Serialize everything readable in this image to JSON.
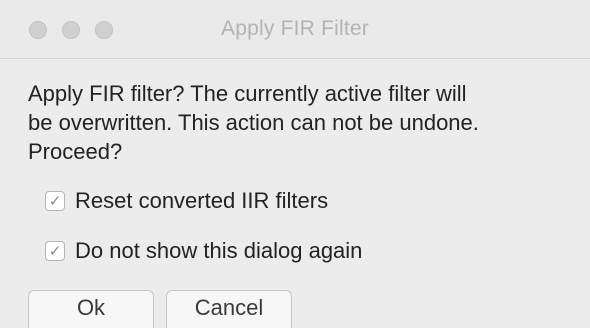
{
  "window": {
    "title": "Apply FIR Filter"
  },
  "dialog": {
    "message_lines": [
      "Apply FIR filter? The currently active filter will",
      "be overwritten. This action can not be undone.",
      "Proceed?"
    ],
    "options": [
      {
        "label": "Reset converted IIR filters",
        "checked": true,
        "mark": "✓"
      },
      {
        "label": "Do not show this dialog again",
        "checked": true,
        "mark": "✓"
      }
    ],
    "buttons": {
      "ok_label": "Ok",
      "cancel_label": "Cancel"
    }
  },
  "icons": {
    "window_controls": [
      "close-icon",
      "minimize-icon",
      "zoom-icon"
    ],
    "checkbox_mark": "checkmark-icon"
  },
  "colors": {
    "background": "#ececec",
    "title_text": "#b3b3b3",
    "body_text": "#222222",
    "traffic_light_inactive": "#d0d0d0"
  }
}
